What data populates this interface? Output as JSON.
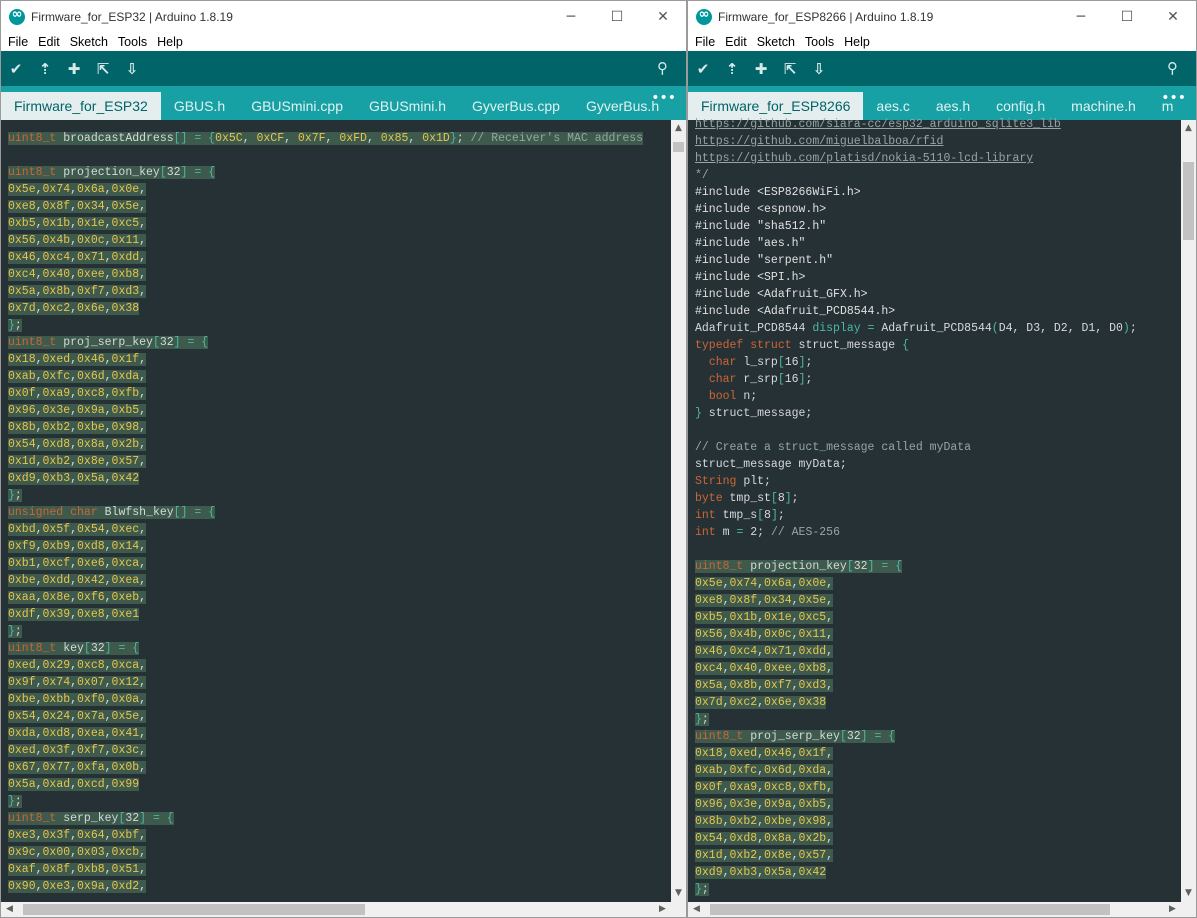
{
  "colors": {
    "toolbar": "#006468",
    "tabbar": "#17a1a5",
    "editor_bg": "#263136",
    "keyword": "#cc6633",
    "literal": "#e8c54b",
    "bracket": "#4db7a3",
    "comment": "#95a5a6",
    "highlight": "#3d5a4c"
  },
  "left": {
    "title": "Firmware_for_ESP32 | Arduino 1.8.19",
    "controls": {
      "minimize": "─",
      "maximize": "☐",
      "close": "✕"
    },
    "menu": [
      "File",
      "Edit",
      "Sketch",
      "Tools",
      "Help"
    ],
    "toolbar": {
      "verify_icon": "checkmark-icon",
      "upload_icon": "upload-arrow-icon",
      "new_icon": "plus-icon",
      "open_icon": "open-icon",
      "save_icon": "save-down-arrow-icon",
      "serial_monitor_icon": "magnifier-icon"
    },
    "tabs": [
      "Firmware_for_ESP32",
      "GBUS.h",
      "GBUSmini.cpp",
      "GBUSmini.h",
      "GyverBus.cpp",
      "GyverBus.h"
    ],
    "tab_more": "•••",
    "code": [
      "uint8_t broadcastAddress[] = {0x5C, 0xCF, 0x7F, 0xFD, 0x85, 0x1D}; // Receiver's MAC address",
      "",
      "uint8_t projection_key[32] = {",
      "0x5e,0x74,0x6a,0x0e,",
      "0xe8,0x8f,0x34,0x5e,",
      "0xb5,0x1b,0x1e,0xc5,",
      "0x56,0x4b,0x0c,0x11,",
      "0x46,0xc4,0x71,0xdd,",
      "0xc4,0x40,0xee,0xb8,",
      "0x5a,0x8b,0xf7,0xd3,",
      "0x7d,0xc2,0x6e,0x38",
      "};",
      "uint8_t proj_serp_key[32] = {",
      "0x18,0xed,0x46,0x1f,",
      "0xab,0xfc,0x6d,0xda,",
      "0x0f,0xa9,0xc8,0xfb,",
      "0x96,0x3e,0x9a,0xb5,",
      "0x8b,0xb2,0xbe,0x98,",
      "0x54,0xd8,0x8a,0x2b,",
      "0x1d,0xb2,0x8e,0x57,",
      "0xd9,0xb3,0x5a,0x42",
      "};",
      "unsigned char Blwfsh_key[] = {",
      "0xbd,0x5f,0x54,0xec,",
      "0xf9,0xb9,0xd8,0x14,",
      "0xb1,0xcf,0xe6,0xca,",
      "0xbe,0xdd,0x42,0xea,",
      "0xaa,0x8e,0xf6,0xeb,",
      "0xdf,0x39,0xe8,0xe1",
      "};",
      "uint8_t key[32] = {",
      "0xed,0x29,0xc8,0xca,",
      "0x9f,0x74,0x07,0x12,",
      "0xbe,0xbb,0xf0,0x0a,",
      "0x54,0x24,0x7a,0x5e,",
      "0xda,0xd8,0xea,0x41,",
      "0xed,0x3f,0xf7,0x3c,",
      "0x67,0x77,0xfa,0x0b,",
      "0x5a,0xad,0xcd,0x99",
      "};",
      "uint8_t serp_key[32] = {",
      "0xe3,0x3f,0x64,0xbf,",
      "0x9c,0x00,0x03,0xcb,",
      "0xaf,0x8f,0xb8,0x51,",
      "0x90,0xe3,0x9a,0xd2,"
    ],
    "scroll": {
      "up": "▲",
      "down": "▼",
      "left": "◀",
      "right": "▶"
    }
  },
  "right": {
    "title": "Firmware_for_ESP8266 | Arduino 1.8.19",
    "controls": {
      "minimize": "─",
      "maximize": "☐",
      "close": "✕"
    },
    "menu": [
      "File",
      "Edit",
      "Sketch",
      "Tools",
      "Help"
    ],
    "toolbar": {
      "verify_icon": "checkmark-icon",
      "upload_icon": "upload-arrow-icon",
      "new_icon": "plus-icon",
      "open_icon": "open-icon",
      "save_icon": "save-down-arrow-icon",
      "serial_monitor_icon": "magnifier-icon"
    },
    "tabs": [
      "Firmware_for_ESP8266",
      "aes.c",
      "aes.h",
      "config.h",
      "machine.h",
      "m"
    ],
    "tab_more": "•••",
    "code": [
      "https://github.com/siara-cc/esp32_arduino_sqlite3_lib",
      "https://github.com/miguelbalboa/rfid",
      "https://github.com/platisd/nokia-5110-lcd-library",
      "*/",
      "#include <ESP8266WiFi.h>",
      "#include <espnow.h>",
      "#include \"sha512.h\"",
      "#include \"aes.h\"",
      "#include \"serpent.h\"",
      "#include <SPI.h>",
      "#include <Adafruit_GFX.h>",
      "#include <Adafruit_PCD8544.h>",
      "Adafruit_PCD8544 display = Adafruit_PCD8544(D4, D3, D2, D1, D0);",
      "typedef struct struct_message {",
      "  char l_srp[16];",
      "  char r_srp[16];",
      "  bool n;",
      "} struct_message;",
      "",
      "// Create a struct_message called myData",
      "struct_message myData;",
      "String plt;",
      "byte tmp_st[8];",
      "int tmp_s[8];",
      "int m = 2; // AES-256",
      "",
      "uint8_t projection_key[32] = {",
      "0x5e,0x74,0x6a,0x0e,",
      "0xe8,0x8f,0x34,0x5e,",
      "0xb5,0x1b,0x1e,0xc5,",
      "0x56,0x4b,0x0c,0x11,",
      "0x46,0xc4,0x71,0xdd,",
      "0xc4,0x40,0xee,0xb8,",
      "0x5a,0x8b,0xf7,0xd3,",
      "0x7d,0xc2,0x6e,0x38",
      "};",
      "uint8_t proj_serp_key[32] = {",
      "0x18,0xed,0x46,0x1f,",
      "0xab,0xfc,0x6d,0xda,",
      "0x0f,0xa9,0xc8,0xfb,",
      "0x96,0x3e,0x9a,0xb5,",
      "0x8b,0xb2,0xbe,0x98,",
      "0x54,0xd8,0x8a,0x2b,",
      "0x1d,0xb2,0x8e,0x57,",
      "0xd9,0xb3,0x5a,0x42",
      "};"
    ],
    "scroll": {
      "up": "▲",
      "down": "▼",
      "left": "◀",
      "right": "▶"
    }
  }
}
